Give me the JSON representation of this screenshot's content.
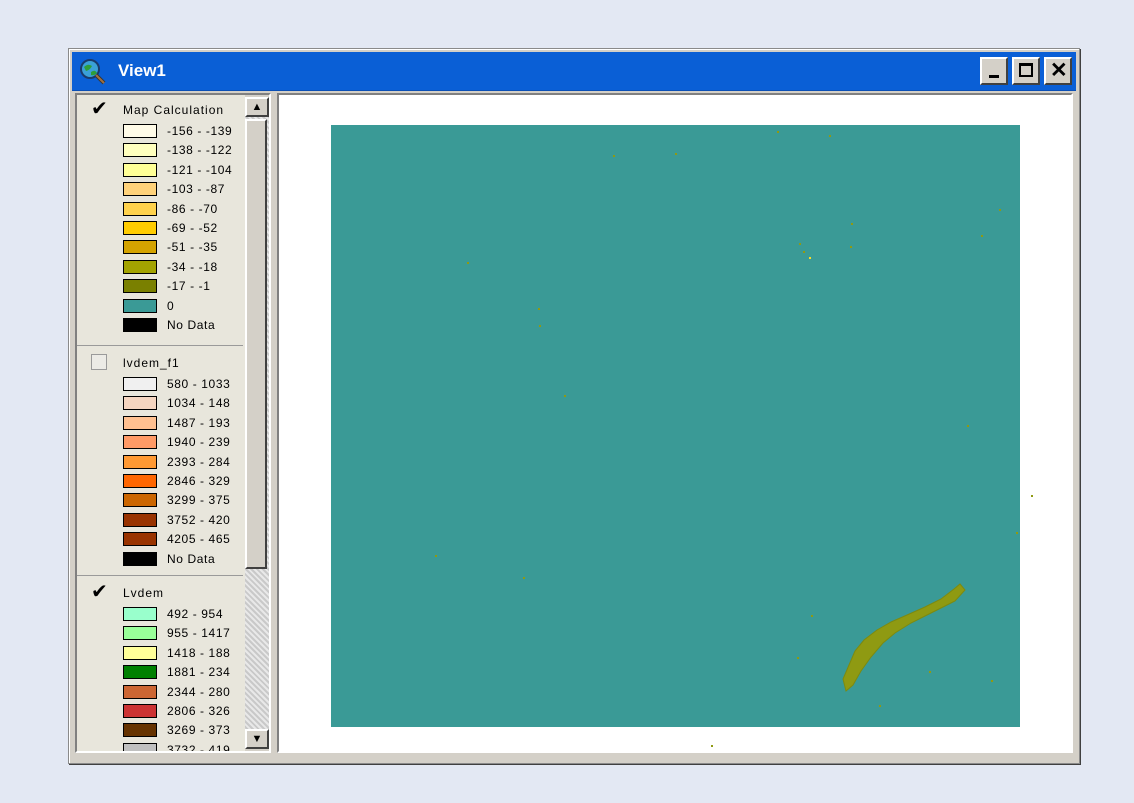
{
  "window": {
    "title": "View1"
  },
  "colors": {
    "titlebar": "#0a5fd6",
    "raster_zero": "#3a9a96",
    "desktop": "#e3e8f3"
  },
  "toc": {
    "layers": [
      {
        "name": "Map Calculation",
        "checked": true,
        "legend": [
          {
            "label": "-156 - -139",
            "color": "#fffbe8"
          },
          {
            "label": "-138 - -122",
            "color": "#ffffbe"
          },
          {
            "label": "-121 - -104",
            "color": "#ffff96"
          },
          {
            "label": "-103 - -87",
            "color": "#ffd27a"
          },
          {
            "label": "-86 - -70",
            "color": "#ffd24c"
          },
          {
            "label": "-69 - -52",
            "color": "#ffcc00"
          },
          {
            "label": "-51 - -35",
            "color": "#d4a300"
          },
          {
            "label": "-34 - -18",
            "color": "#a3a300"
          },
          {
            "label": "-17 - -1",
            "color": "#7a8000"
          },
          {
            "label": "0",
            "color": "#3a9a96"
          },
          {
            "label": "No Data",
            "color": "#000000"
          }
        ]
      },
      {
        "name": "lvdem_f1",
        "checked": false,
        "legend": [
          {
            "label": "580 - 1033",
            "color": "#f0f0f0"
          },
          {
            "label": "1034 - 148",
            "color": "#f5d5c0"
          },
          {
            "label": "1487 - 193",
            "color": "#ffc090"
          },
          {
            "label": "1940 - 239",
            "color": "#ff9a66"
          },
          {
            "label": "2393 - 284",
            "color": "#ff9933"
          },
          {
            "label": "2846 - 329",
            "color": "#ff6600"
          },
          {
            "label": "3299 - 375",
            "color": "#cc6600"
          },
          {
            "label": "3752 - 420",
            "color": "#993300"
          },
          {
            "label": "4205 - 465",
            "color": "#993300"
          },
          {
            "label": "No Data",
            "color": "#000000"
          }
        ]
      },
      {
        "name": "Lvdem",
        "checked": true,
        "legend": [
          {
            "label": "492 - 954",
            "color": "#99ffcc"
          },
          {
            "label": "955 - 1417",
            "color": "#99ff99"
          },
          {
            "label": "1418 - 188",
            "color": "#ffff99"
          },
          {
            "label": "1881 - 234",
            "color": "#008000"
          },
          {
            "label": "2344 - 280",
            "color": "#cc6633"
          },
          {
            "label": "2806 - 326",
            "color": "#cc3333"
          },
          {
            "label": "3269 - 373",
            "color": "#663300"
          },
          {
            "label": "3732 - 419",
            "color": "#c0c0c0"
          }
        ]
      }
    ]
  }
}
